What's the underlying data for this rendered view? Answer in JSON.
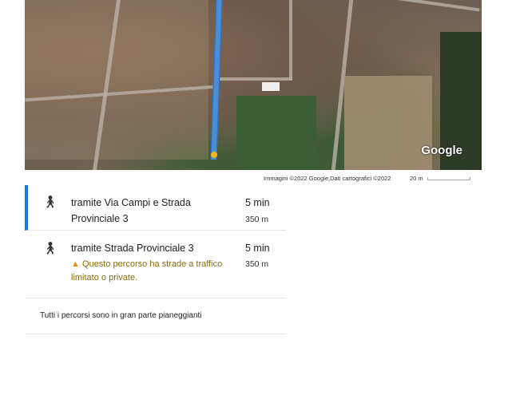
{
  "map": {
    "logo": "Google",
    "attribution": "Immagini ©2022 Google,Dati cartografici ©2022",
    "scale": "20 m",
    "route_color": "#4a8fd6"
  },
  "routes": [
    {
      "title": "tramite Via Campi e Strada Provinciale 3",
      "time": "5 min",
      "distance": "350 m",
      "selected": true,
      "icon": "walking-icon"
    },
    {
      "title": "tramite Strada Provinciale 3",
      "time": "5 min",
      "distance": "350 m",
      "selected": false,
      "icon": "walking-icon",
      "warning": "Questo percorso ha strade a traffico limitato o private."
    }
  ],
  "footer_note": "Tutti i percorsi sono in gran parte pianeggianti",
  "colors": {
    "accent": "#1a73e8",
    "warning": "#e8910c"
  }
}
